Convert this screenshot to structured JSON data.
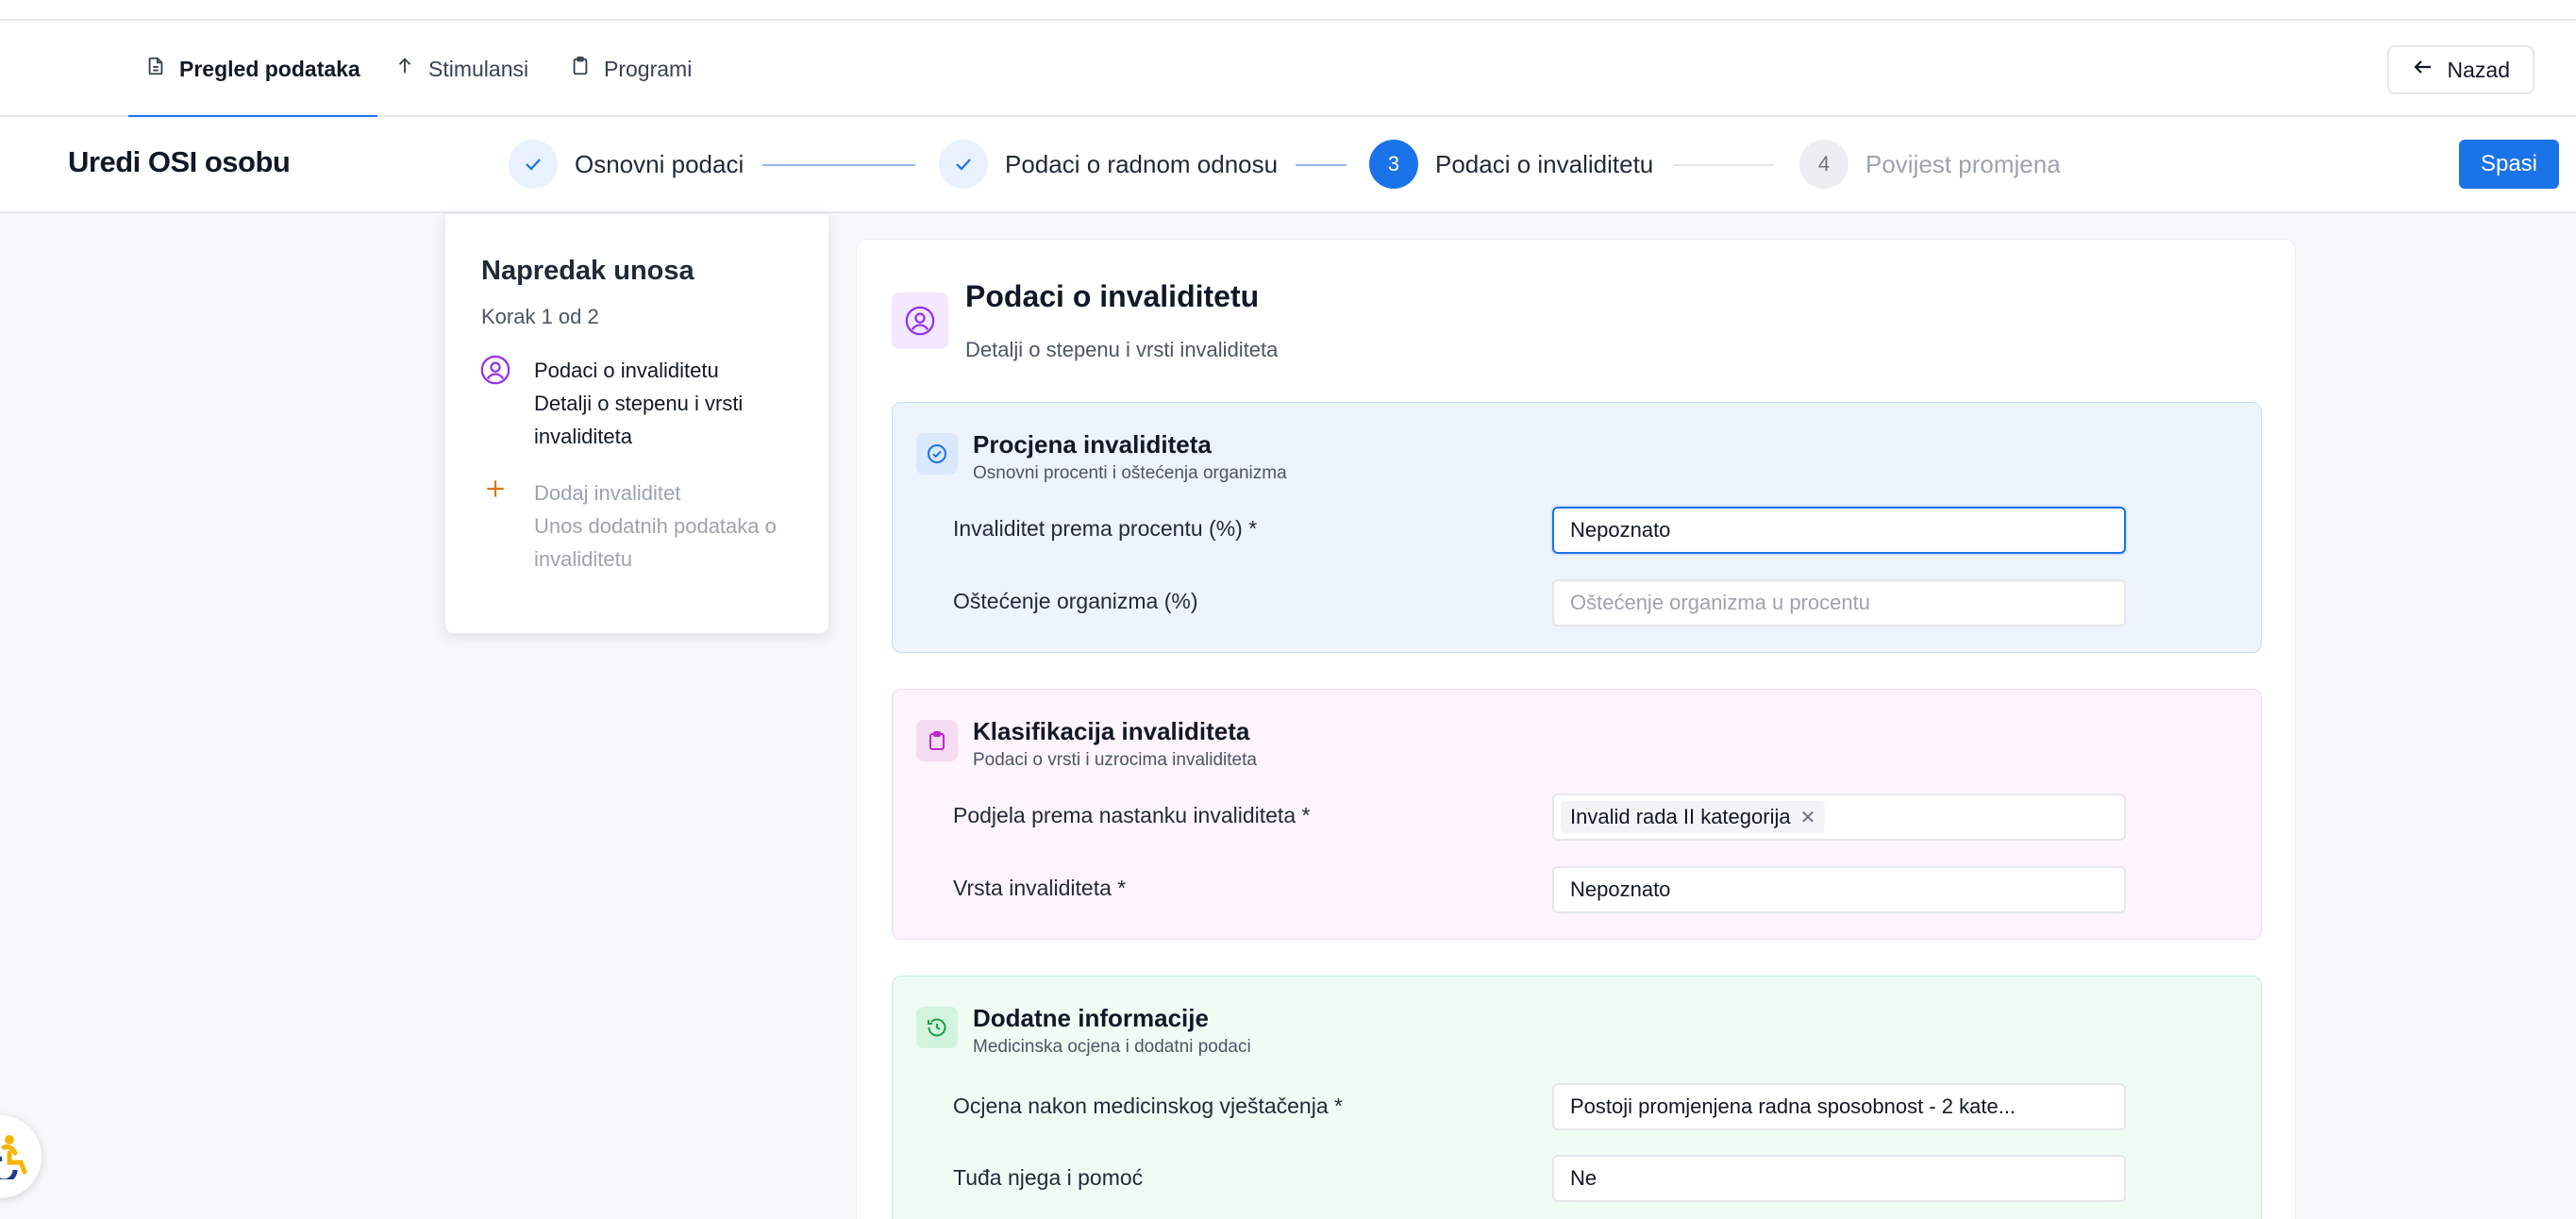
{
  "tabs": [
    {
      "label": "Pregled podataka",
      "icon": "document-icon",
      "active": true
    },
    {
      "label": "Stimulansi",
      "icon": "arrow-up-icon",
      "active": false
    },
    {
      "label": "Programi",
      "icon": "clipboard-icon",
      "active": false
    }
  ],
  "header": {
    "back_label": "Nazad",
    "title": "Uredi OSI osobu",
    "save_label": "Spasi"
  },
  "stepper": [
    {
      "number": "",
      "label": "Osnovni podaci",
      "state": "done"
    },
    {
      "number": "",
      "label": "Podaci o radnom odnosu",
      "state": "done"
    },
    {
      "number": "3",
      "label": "Podaci o invaliditetu",
      "state": "current"
    },
    {
      "number": "4",
      "label": "Povijest promjena",
      "state": "pending"
    }
  ],
  "progress": {
    "title": "Napredak unosa",
    "step_text": "Korak 1 od 2",
    "items": [
      {
        "title": "Podaci o invaliditetu",
        "desc": "Detalji o stepenu i vrsti invaliditeta",
        "icon": "user-circle-icon",
        "active": true
      },
      {
        "title": "Dodaj invaliditet",
        "desc": "Unos dodatnih podataka o invaliditetu",
        "icon": "plus-icon",
        "active": false
      }
    ]
  },
  "main": {
    "title": "Podaci o invaliditetu",
    "subtitle": "Detalji o stepenu i vrsti invaliditeta"
  },
  "sections": {
    "assessment": {
      "title": "Procjena invaliditeta",
      "subtitle": "Osnovni procenti i oštećenja organizma",
      "fields": [
        {
          "label": "Invaliditet prema procentu (%) *",
          "value": "Nepoznato",
          "placeholder": ""
        },
        {
          "label": "Oštećenje organizma (%)",
          "value": "",
          "placeholder": "Oštećenje organizma u procentu"
        }
      ]
    },
    "classification": {
      "title": "Klasifikacija invaliditeta",
      "subtitle": "Podaci o vrsti i uzrocima invaliditeta",
      "fields": [
        {
          "label": "Podjela prema nastanku invaliditeta *",
          "chip": "Invalid rada II kategorija"
        },
        {
          "label": "Vrsta invaliditeta *",
          "value": "Nepoznato"
        }
      ]
    },
    "additional": {
      "title": "Dodatne informacije",
      "subtitle": "Medicinska ocjena i dodatni podaci",
      "fields": [
        {
          "label": "Ocjena nakon medicinskog vještačenja *",
          "value": "Postoji promjenjena radna sposobnost - 2 kate..."
        },
        {
          "label": "Tuđa njega i pomoć",
          "value": "Ne"
        }
      ]
    }
  },
  "colors": {
    "accent": "#1a73e8",
    "assessment_bg": "#eef4fe",
    "classification_bg": "#fdf4fc",
    "additional_bg": "#effcf4"
  }
}
